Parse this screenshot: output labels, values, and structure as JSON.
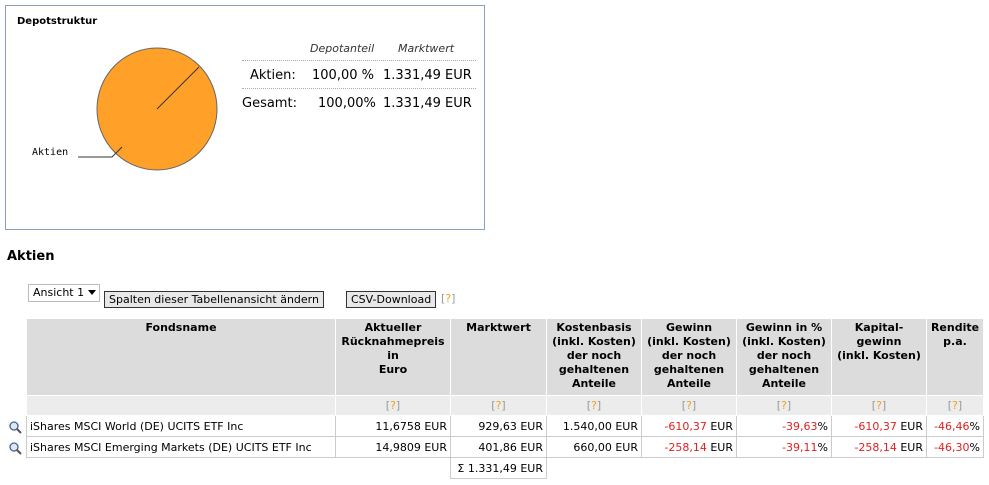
{
  "panel": {
    "title": "Depotstruktur",
    "pie_label": "Aktien",
    "pie_color": "#ffa028",
    "summary": {
      "col_headers": [
        "Depotanteil",
        "Marktwert"
      ],
      "rows": [
        {
          "label": "Aktien:",
          "share": "100,00 %",
          "value": "1.331,49 EUR"
        },
        {
          "label": "Gesamt:",
          "share": "100,00%",
          "value": "1.331,49 EUR"
        }
      ]
    }
  },
  "section_title": "Aktien",
  "controls": {
    "view_select": "Ansicht 1",
    "columns_button": "Spalten dieser Tabellenansicht ändern",
    "csv_button": "CSV-Download",
    "help_mark": "?"
  },
  "table": {
    "headers": {
      "fondsname": "Fondsname",
      "ruecknahme": [
        "Aktueller",
        "Rücknahmepreis",
        "in",
        "Euro"
      ],
      "marktwert": "Marktwert",
      "kostenbasis": [
        "Kostenbasis",
        "(inkl. Kosten)",
        "der noch",
        "gehaltenen",
        "Anteile"
      ],
      "gewinn": [
        "Gewinn",
        "(inkl. Kosten)",
        "der noch",
        "gehaltenen",
        "Anteile"
      ],
      "gewinn_pct": [
        "Gewinn in %",
        "(inkl. Kosten)",
        "der noch",
        "gehaltenen",
        "Anteile"
      ],
      "kapitalgewinn": [
        "Kapital-",
        "gewinn",
        "(inkl. Kosten)"
      ],
      "rendite": [
        "Rendite",
        "p.a."
      ]
    },
    "rows": [
      {
        "name": "iShares MSCI World (DE) UCITS ETF Inc",
        "price": "11,6758 EUR",
        "market_value": "929,63 EUR",
        "cost_basis": "1.540,00 EUR",
        "gain": "-610,37",
        "gain_unit": " EUR",
        "gain_pct": "-39,63",
        "gain_pct_unit": "%",
        "capital_gain": "-610,37",
        "capital_gain_unit": " EUR",
        "return_pa": "-46,46",
        "return_pa_unit": "%"
      },
      {
        "name": "iShares MSCI Emerging Markets (DE) UCITS ETF Inc",
        "price": "14,9809 EUR",
        "market_value": "401,86 EUR",
        "cost_basis": "660,00 EUR",
        "gain": "-258,14",
        "gain_unit": " EUR",
        "gain_pct": "-39,11",
        "gain_pct_unit": "%",
        "capital_gain": "-258,14",
        "capital_gain_unit": " EUR",
        "return_pa": "-46,30",
        "return_pa_unit": "%"
      }
    ],
    "sum_market_value": "Σ 1.331,49 EUR"
  }
}
